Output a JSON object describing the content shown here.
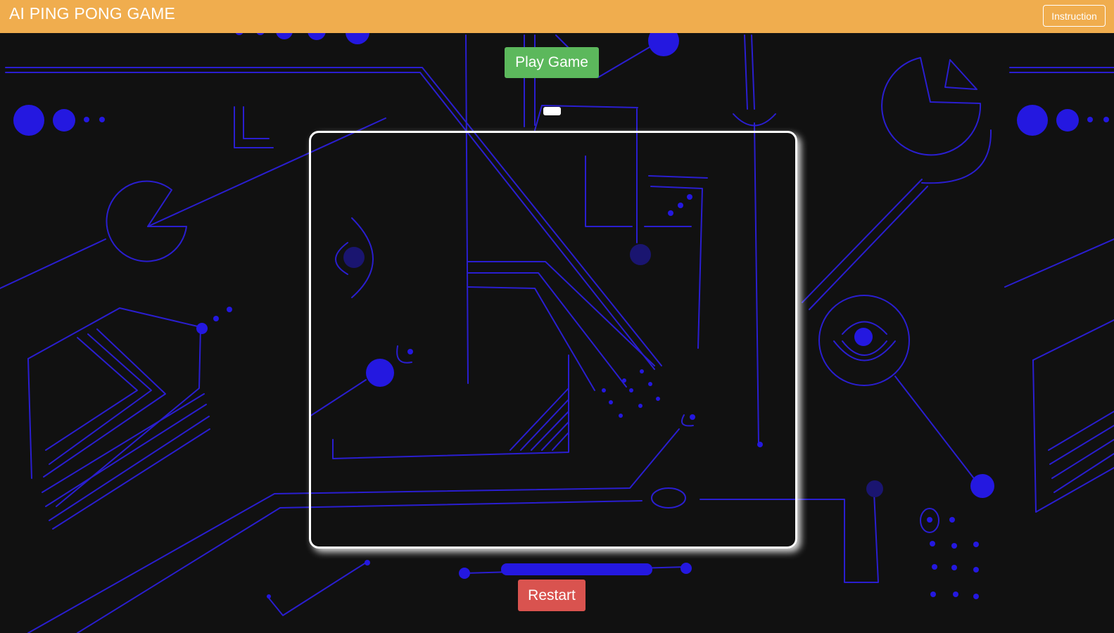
{
  "header": {
    "title": "AI PING PONG GAME",
    "instruction_label": "Instruction"
  },
  "controls": {
    "play_label": "Play Game",
    "restart_label": "Restart"
  },
  "game": {
    "ai_paddle": "white-paddle",
    "board": "game-board"
  },
  "colors": {
    "header_bg": "#f0ad4e",
    "play_button": "#5cb85c",
    "restart_button": "#d9534f",
    "background": "#111111",
    "circuit_line": "#2a1ed0",
    "circuit_dot": "#2418e0"
  }
}
